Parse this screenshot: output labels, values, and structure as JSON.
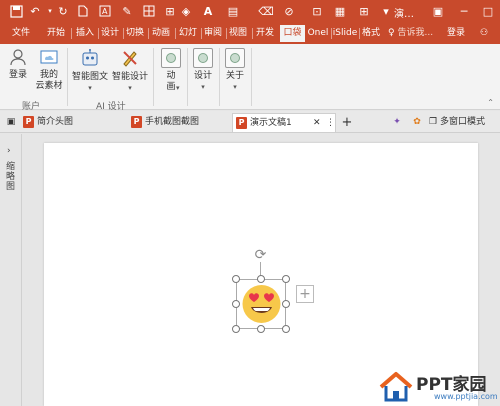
{
  "titlebar": {
    "title": "演…",
    "qa_icons": [
      "save-icon",
      "undo-icon",
      "redo-icon",
      "new-file-icon",
      "text-box-icon",
      "pen-icon",
      "table-icon",
      "layout-icon",
      "fill-color-icon",
      "font-color-icon",
      "format-painter-icon",
      "eraser-icon",
      "shape-outline-icon",
      "fullscreen-icon",
      "color-picker-icon",
      "more-icon"
    ]
  },
  "tabs": [
    {
      "label": "文件"
    },
    {
      "label": "开始"
    },
    {
      "label": "插入"
    },
    {
      "label": "设计"
    },
    {
      "label": "切换"
    },
    {
      "label": "动画"
    },
    {
      "label": "幻灯"
    },
    {
      "label": "审阅"
    },
    {
      "label": "视图"
    },
    {
      "label": "开发"
    },
    {
      "label": "口袋"
    },
    {
      "label": "Onel"
    },
    {
      "label": "iSlide"
    },
    {
      "label": "格式"
    }
  ],
  "tell_me": "告诉我...",
  "login": "登录",
  "ribbon": {
    "account_group": "账户",
    "ai_group": "AI 设计",
    "login_btn": "登录",
    "cloud_btn_1": "我的",
    "cloud_btn_2": "云素材",
    "smart_text": "智能图文",
    "smart_design": "智能设计",
    "anim_1": "动",
    "anim_2": "画",
    "design": "设计",
    "about": "关于"
  },
  "doc_tabs": [
    {
      "label": "简介头图"
    },
    {
      "label": "手机截图截图"
    },
    {
      "label": "演示文稿1",
      "active": true
    }
  ],
  "multi_window": "多窗口模式",
  "side_label": "缩略图",
  "watermark": {
    "brand": "PPT家园",
    "url": "www.pptjia.com"
  },
  "colors": {
    "accent": "#c84a2c",
    "ribbon_bg": "#f3f3f3",
    "slide_bg": "#ffffff"
  }
}
